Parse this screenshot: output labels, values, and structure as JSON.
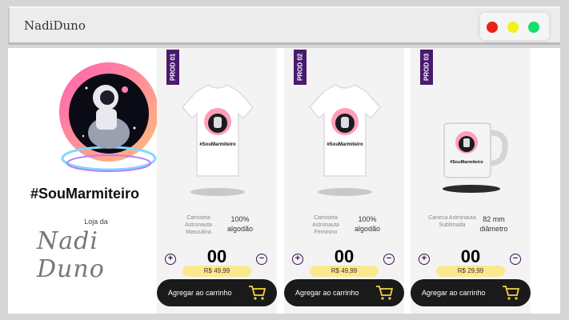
{
  "window": {
    "title": "NadiDuno",
    "controls": [
      "close",
      "minimize",
      "maximize"
    ]
  },
  "brand": {
    "tagline": "#SouMarmiteiro",
    "store_label": "Loja da",
    "signature": "Nadi Duno"
  },
  "products": [
    {
      "badge": "PROD 01",
      "image_icon": "tshirt-icon",
      "image_text": "#SouMarmiteiro",
      "description": "Camiseta Astronauta Masculina",
      "spec": "100% algodão",
      "quantity": "00",
      "price": "R$ 49,99",
      "button_label": "Agregar ao carrinho"
    },
    {
      "badge": "PROD 02",
      "image_icon": "tshirt-icon",
      "image_text": "#SouMarmiteiro",
      "description": "Camiseta Astronauta Feminino",
      "spec": "100% algodão",
      "quantity": "00",
      "price": "R$ 49,99",
      "button_label": "Agregar ao carrinho"
    },
    {
      "badge": "PROD 03",
      "image_icon": "mug-icon",
      "image_text": "#SouMarmiteiro",
      "description": "Caneca Astronauta Sublimada",
      "spec": "82 mm diâmetro",
      "quantity": "00",
      "price": "R$ 29,99",
      "button_label": "Agregar ao carrinho"
    }
  ],
  "colors": {
    "badge": "#4a1a6e",
    "price_pill": "#fbe98f",
    "cart_button": "#1a1a1a",
    "cart_icon": "#f5d33b"
  }
}
